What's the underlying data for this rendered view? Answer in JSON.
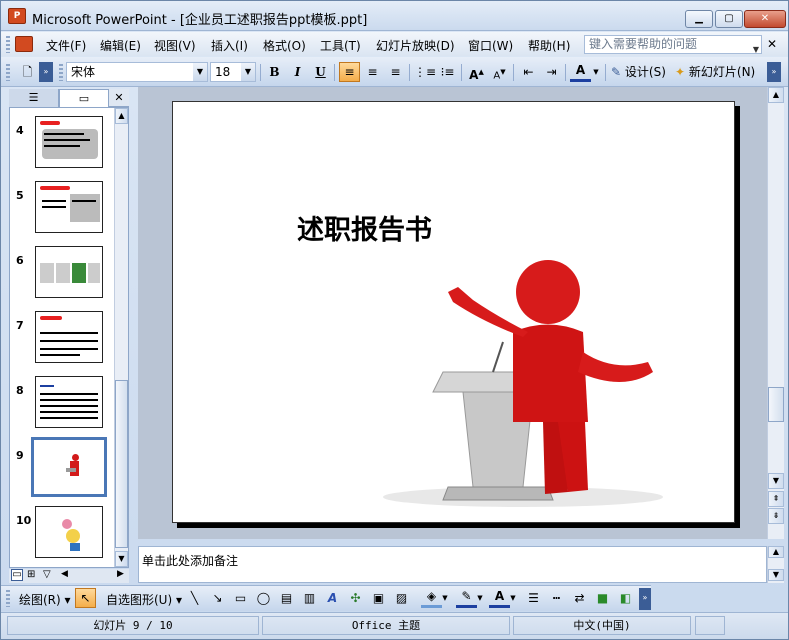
{
  "window": {
    "title": "Microsoft PowerPoint - [企业员工述职报告ppt模板.ppt]",
    "app_icon": "P"
  },
  "menu": {
    "items": [
      "文件(F)",
      "编辑(E)",
      "视图(V)",
      "插入(I)",
      "格式(O)",
      "工具(T)",
      "幻灯片放映(D)",
      "窗口(W)",
      "帮助(H)"
    ],
    "help_placeholder": "键入需要帮助的问题"
  },
  "toolbar": {
    "font_name": "宋体",
    "font_size": "18",
    "bold": "B",
    "italic": "I",
    "underline": "U",
    "design_label": "设计(S)",
    "new_slide_label": "新幻灯片(N)"
  },
  "thumbnails": [
    {
      "number": "4"
    },
    {
      "number": "5"
    },
    {
      "number": "6"
    },
    {
      "number": "7"
    },
    {
      "number": "8"
    },
    {
      "number": "9",
      "selected": true
    },
    {
      "number": "10"
    }
  ],
  "slide": {
    "title": "述职报告书"
  },
  "notes": {
    "placeholder": "单击此处添加备注"
  },
  "drawbar": {
    "draw_label": "绘图(R)",
    "autoshapes_label": "自选图形(U)"
  },
  "status": {
    "slide_info": "幻灯片 9 / 10",
    "theme": "Office 主题",
    "language": "中文(中国)"
  }
}
